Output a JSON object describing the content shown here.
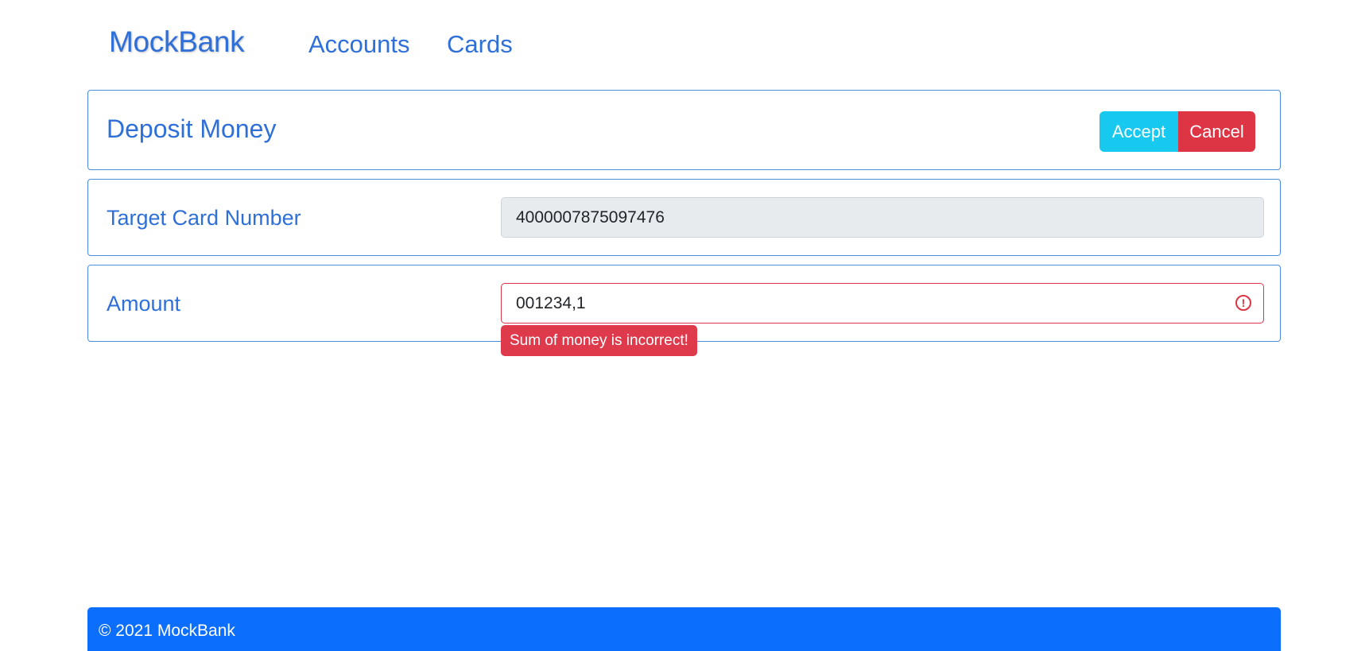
{
  "navbar": {
    "brand": "MockBank",
    "links": [
      {
        "label": "Accounts"
      },
      {
        "label": "Cards"
      }
    ]
  },
  "header": {
    "title": "Deposit Money",
    "accept_label": "Accept",
    "cancel_label": "Cancel"
  },
  "form": {
    "target_card": {
      "label": "Target Card Number",
      "value": "4000007875097476"
    },
    "amount": {
      "label": "Amount",
      "value": "001234,1",
      "error_icon": "exclamation-circle-icon",
      "error_message": "Sum of money is incorrect!"
    }
  },
  "footer": {
    "text": "© 2021 MockBank"
  },
  "colors": {
    "primary_text": "#2f6fd8",
    "accept": "#17c9ee",
    "cancel": "#de3545",
    "footer": "#0b6efd",
    "invalid": "#dc3545"
  }
}
